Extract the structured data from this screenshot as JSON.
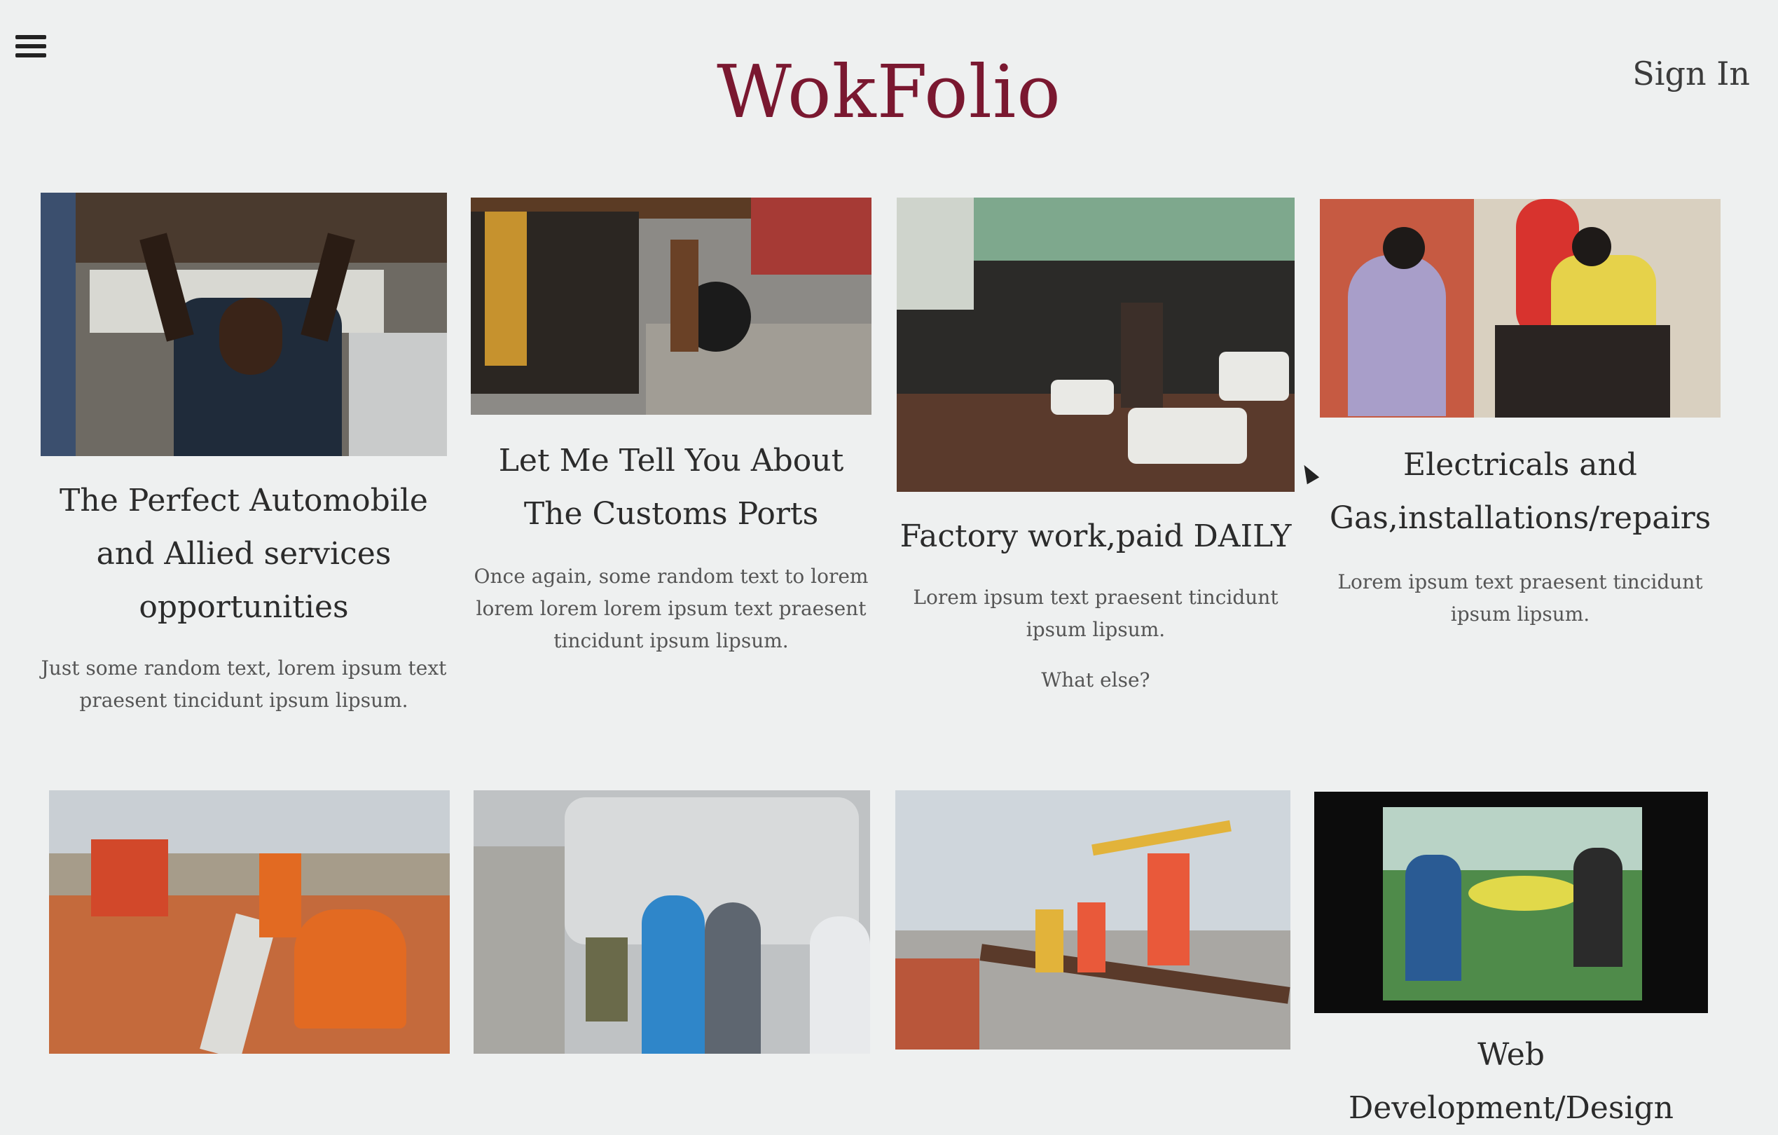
{
  "header": {
    "brand": "WokFolio",
    "signin": "Sign In"
  },
  "cards": [
    {
      "title": "The Perfect Automobile and Allied services opportunities",
      "text": "Just some random text, lorem ipsum text praesent tincidunt ipsum lipsum.",
      "image": "mechanic-under-car-photo"
    },
    {
      "title": "Let Me Tell You About The Customs Ports",
      "text": "Once again, some random text to lorem lorem lorem lorem ipsum text praesent tincidunt ipsum lipsum.",
      "image": "tyre-market-photo"
    },
    {
      "title": "Factory work,paid DAILY",
      "text": "Lorem ipsum text praesent tincidunt ipsum lipsum.",
      "extra": "What else?",
      "image": "factory-warehouse-photo"
    },
    {
      "title": "Electricals and Gas,installations/repairs",
      "text": "Lorem ipsum text praesent tincidunt ipsum lipsum.",
      "image": "gas-installation-photo"
    },
    {
      "image": "road-construction-photo"
    },
    {
      "image": "people-handshake-photo"
    },
    {
      "image": "railway-workers-photo"
    },
    {
      "title": "Web Development/Design",
      "image": "team-meeting-outdoor-photo"
    }
  ]
}
